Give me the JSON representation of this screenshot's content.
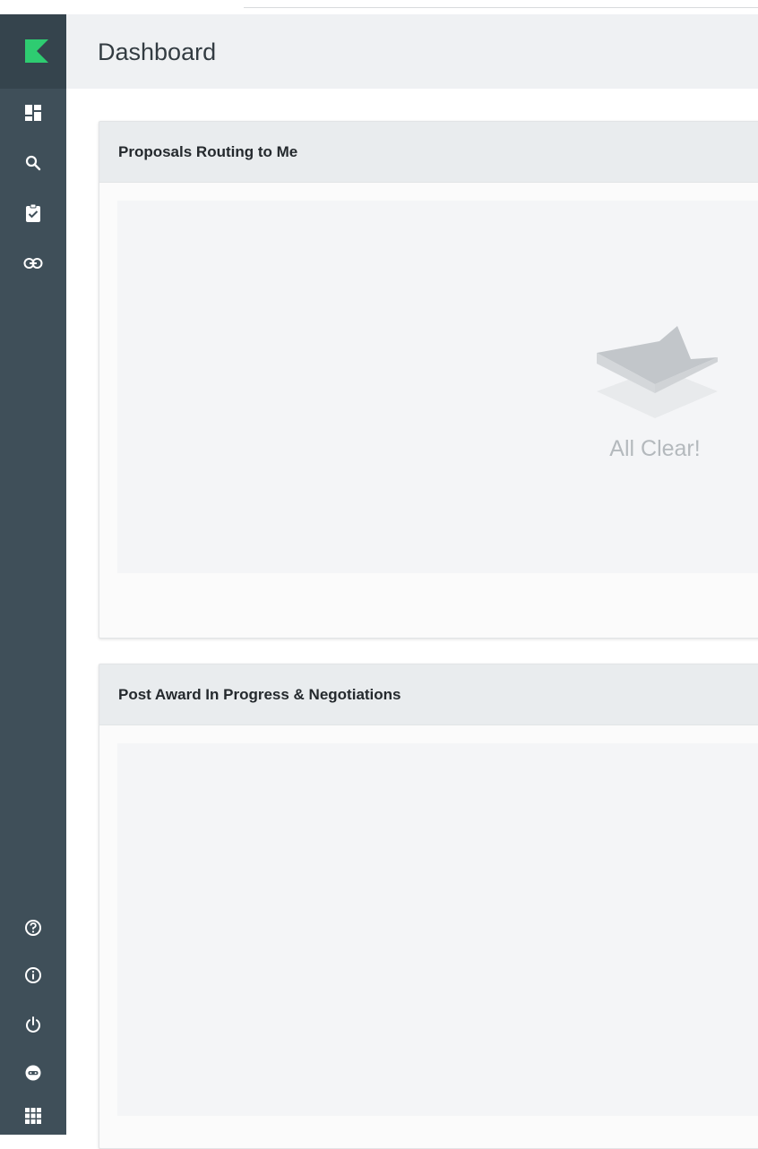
{
  "page": {
    "title": "Dashboard"
  },
  "sidebar": {
    "top_items": [
      {
        "icon": "dashboard-icon",
        "label": "Dashboard"
      },
      {
        "icon": "search-icon",
        "label": "Search"
      },
      {
        "icon": "clipboard-check-icon",
        "label": "Tasks"
      },
      {
        "icon": "link-icon",
        "label": "Links"
      }
    ],
    "bottom_items": [
      {
        "icon": "help-icon",
        "label": "Help"
      },
      {
        "icon": "info-icon",
        "label": "Info"
      },
      {
        "icon": "power-icon",
        "label": "Sign out"
      },
      {
        "icon": "user-avatar-icon",
        "label": "Profile"
      },
      {
        "icon": "apps-grid-icon",
        "label": "Apps"
      }
    ]
  },
  "cards": {
    "proposals_routing": {
      "title": "Proposals Routing to Me",
      "empty_message": "All Clear!"
    },
    "post_award": {
      "title": "Post Award In Progress & Negotiations"
    }
  },
  "colors": {
    "sidebar": "#3f4f59",
    "logo_bg": "#35444d",
    "brand_green": "#2ecc71",
    "header_bg": "#eff1f3",
    "card_header_bg": "#e9ecee",
    "empty_icon": "#c2c6ca"
  }
}
